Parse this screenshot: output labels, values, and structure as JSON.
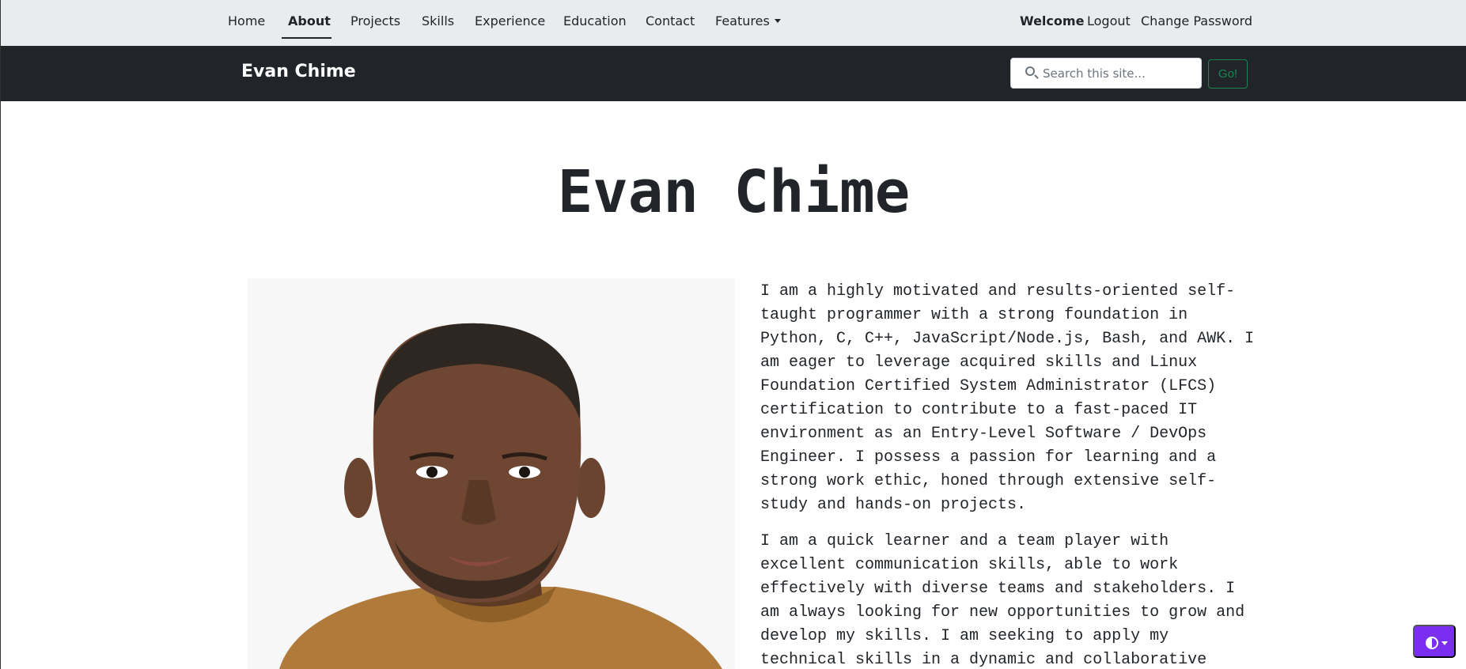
{
  "topnav": {
    "items": [
      "Home",
      "About",
      "Projects",
      "Skills",
      "Experience",
      "Education",
      "Contact",
      "Features"
    ],
    "welcome": "Welcome",
    "logout": "Logout",
    "change_password": "Change Password"
  },
  "header": {
    "brand": "Evan Chime",
    "search_placeholder": "Search this site...",
    "go_label": "Go!"
  },
  "main": {
    "title": "Evan Chime",
    "bio": [
      "I am a highly motivated and results-oriented self-taught programmer with a strong foundation in Python, C, C++, JavaScript/Node.js, Bash, and AWK. I am eager to leverage acquired skills and Linux Foundation Certified System Administrator (LFCS) certification to contribute to a fast-paced IT environment as an Entry-Level Software / DevOps Engineer. I possess a passion for learning and a strong work ethic, honed through extensive self-study and hands-on projects.",
      "I am a quick learner and a team player with excellent communication skills, able to work effectively with diverse teams and stakeholders. I am always looking for new opportunities to grow and develop my skills. I am seeking to apply my technical skills in a dynamic and collaborative"
    ]
  },
  "colors": {
    "accent": "#7a2ff0",
    "dark": "#212529",
    "go": "#198754"
  },
  "icons": {
    "search": "search-icon",
    "theme": "contrast-icon"
  }
}
